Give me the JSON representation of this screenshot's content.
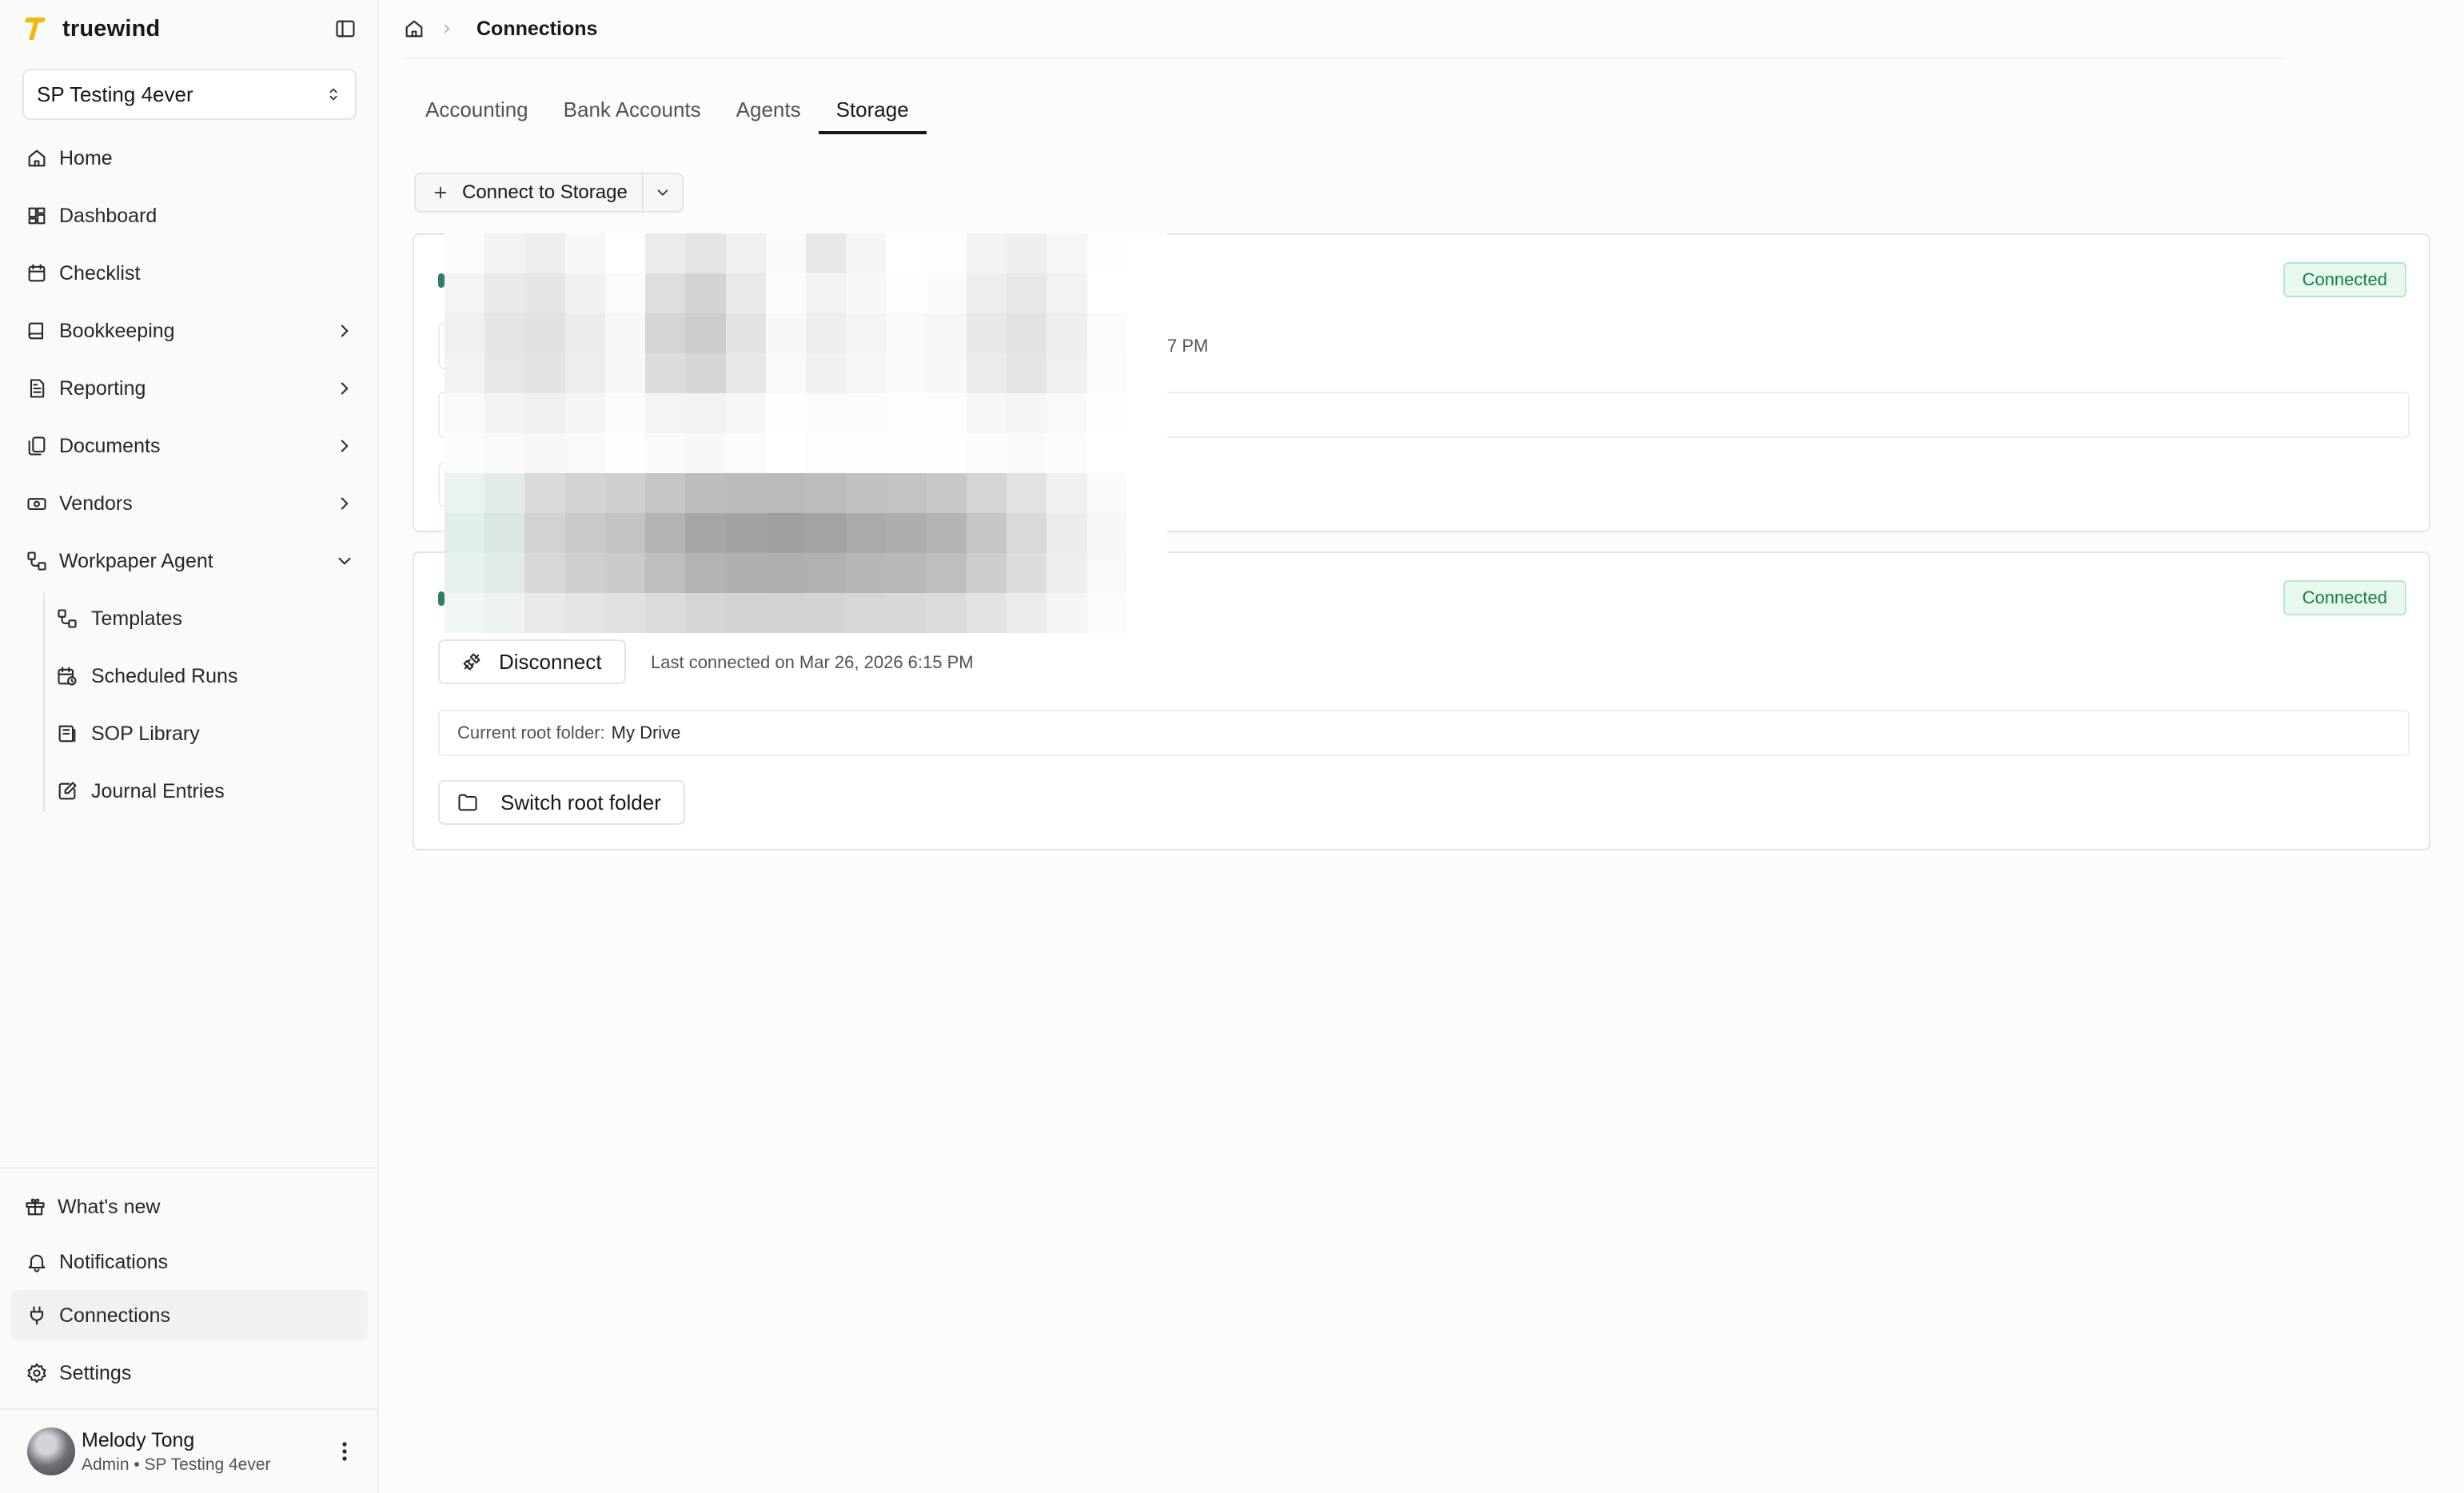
{
  "brand": {
    "name": "truewind",
    "logo_color": "#f5b800"
  },
  "workspace": {
    "name": "SP Testing 4ever"
  },
  "nav": {
    "items": [
      {
        "label": "Home",
        "icon": "home-icon"
      },
      {
        "label": "Dashboard",
        "icon": "dashboard-icon"
      },
      {
        "label": "Checklist",
        "icon": "calendar-check-icon"
      },
      {
        "label": "Bookkeeping",
        "icon": "book-icon"
      },
      {
        "label": "Reporting",
        "icon": "report-icon"
      },
      {
        "label": "Documents",
        "icon": "documents-icon"
      },
      {
        "label": "Vendors",
        "icon": "vendors-icon"
      },
      {
        "label": "Workpaper Agent",
        "icon": "workflow-icon"
      }
    ],
    "sub_items": [
      {
        "label": "Templates",
        "icon": "workflow-icon"
      },
      {
        "label": "Scheduled Runs",
        "icon": "calendar-clock-icon"
      },
      {
        "label": "SOP Library",
        "icon": "library-icon"
      },
      {
        "label": "Journal Entries",
        "icon": "journal-edit-icon"
      }
    ]
  },
  "bottom_nav": [
    {
      "label": "What's new",
      "icon": "gift-icon"
    },
    {
      "label": "Notifications",
      "icon": "bell-icon"
    },
    {
      "label": "Connections",
      "icon": "plug-icon"
    },
    {
      "label": "Settings",
      "icon": "gear-icon"
    }
  ],
  "user": {
    "name": "Melody Tong",
    "role": "Admin • SP Testing 4ever"
  },
  "breadcrumb": {
    "current": "Connections"
  },
  "tabs": [
    {
      "label": "Accounting"
    },
    {
      "label": "Bank Accounts"
    },
    {
      "label": "Agents"
    },
    {
      "label": "Storage"
    }
  ],
  "connect_button": {
    "label": "Connect to Storage"
  },
  "cards": [
    {
      "status": "Connected",
      "last_connected_fragment": "7 PM"
    },
    {
      "status": "Connected",
      "disconnect_label": "Disconnect",
      "last_connected": "Last connected on Mar 26, 2026 6:15 PM",
      "root_folder_label": "Current root folder:",
      "root_folder_value": "My Drive",
      "switch_label": "Switch root folder"
    }
  ],
  "colors": {
    "accent_text": "#18181b",
    "connected_badge_bg": "#e7f8ef",
    "connected_badge_text": "#15803d"
  }
}
